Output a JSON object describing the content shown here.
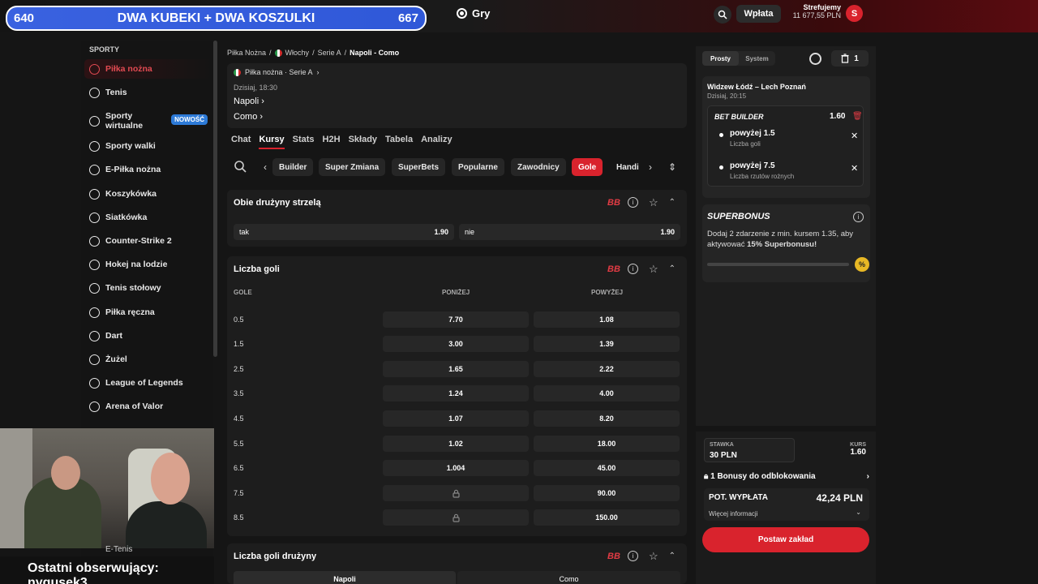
{
  "overlay": {
    "goal_left": "640",
    "goal_title": "DWA KUBEKI + DWA KOSZULKI",
    "goal_right": "667",
    "last_follower": "Ostatni obserwujący: nygusek3"
  },
  "header": {
    "games_label": "Gry",
    "deposit_label": "Wpłata",
    "user_name": "Strefujemy",
    "balance": "11 677,55 PLN",
    "avatar_letter": "S"
  },
  "sidebar": {
    "header": "SPORTY",
    "items": [
      {
        "label": "Piłka nożna"
      },
      {
        "label": "Tenis"
      },
      {
        "label": "Sporty wirtualne",
        "badge": "NOWOŚĆ"
      },
      {
        "label": "Sporty walki"
      },
      {
        "label": "E-Piłka nożna"
      },
      {
        "label": "Koszykówka"
      },
      {
        "label": "Siatkówka"
      },
      {
        "label": "Counter-Strike 2"
      },
      {
        "label": "Hokej na lodzie"
      },
      {
        "label": "Tenis stołowy"
      },
      {
        "label": "Piłka ręczna"
      },
      {
        "label": "Dart"
      },
      {
        "label": "Żużel"
      },
      {
        "label": "League of Legends"
      },
      {
        "label": "Arena of Valor"
      }
    ],
    "partial_item": "E-Tenis"
  },
  "breadcrumb": [
    "Piłka Nożna",
    "Włochy",
    "Serie A",
    "Napoli - Como"
  ],
  "match": {
    "league": "Piłka nożna · Serie A",
    "time": "Dzisiaj, 18:30",
    "team1": "Napoli",
    "team2": "Como"
  },
  "tabs": [
    "Chat",
    "Kursy",
    "Stats",
    "H2H",
    "Składy",
    "Tabela",
    "Analizy"
  ],
  "chips": [
    "Builder",
    "Super Zmiana",
    "SuperBets",
    "Popularne",
    "Zawodnicy",
    "Gole",
    "Handi"
  ],
  "markets": {
    "btts": {
      "title": "Obie drużyny strzelą",
      "bb": "BB",
      "yes_label": "tak",
      "yes_odd": "1.90",
      "no_label": "nie",
      "no_odd": "1.90"
    },
    "goals": {
      "title": "Liczba goli",
      "bb": "BB",
      "col_line": "GOLE",
      "col_under": "PONIŻEJ",
      "col_over": "POWYŻEJ",
      "rows": [
        {
          "line": "0.5",
          "under": "7.70",
          "over": "1.08"
        },
        {
          "line": "1.5",
          "under": "3.00",
          "over": "1.39"
        },
        {
          "line": "2.5",
          "under": "1.65",
          "over": "2.22"
        },
        {
          "line": "3.5",
          "under": "1.24",
          "over": "4.00"
        },
        {
          "line": "4.5",
          "under": "1.07",
          "over": "8.20"
        },
        {
          "line": "5.5",
          "under": "1.02",
          "over": "18.00"
        },
        {
          "line": "6.5",
          "under": "1.004",
          "over": "45.00"
        },
        {
          "line": "7.5",
          "under": "",
          "over": "90.00"
        },
        {
          "line": "8.5",
          "under": "",
          "over": "150.00"
        }
      ]
    },
    "team_goals": {
      "title": "Liczba goli drużyny",
      "bb": "BB",
      "team1": "Napoli",
      "team2": "Como"
    }
  },
  "betslip": {
    "mode_single": "Prosty",
    "mode_system": "System",
    "count": "1",
    "match": "Widzew Łódź – Lech Poznań",
    "time": "Dzisiaj, 20:15",
    "bb_label": "BET BUILDER",
    "bb_odd": "1.60",
    "legs": [
      {
        "sel": "powyżej 1.5",
        "desc": "Liczba goli"
      },
      {
        "sel": "powyżej 7.5",
        "desc": "Liczba rzutów rożnych"
      }
    ],
    "superbonus_title": "SUPERBONUS",
    "superbonus_desc_a": "Dodaj 2 zdarzenie z min. kursem 1.35, aby aktywować ",
    "superbonus_desc_b": "15% Superbonusu!",
    "superbonus_progress": 0,
    "pct_icon": "%",
    "stake_label": "STAWKA",
    "stake_value": "30 PLN",
    "odds_label": "KURS",
    "odds_value": "1.60",
    "bonus_text": "1 Bonusy do odblokowania",
    "payout_label": "POT. WYPŁATA",
    "payout_value": "42,24 PLN",
    "more_info": "Więcej informacji",
    "place_bet": "Postaw zakład"
  }
}
